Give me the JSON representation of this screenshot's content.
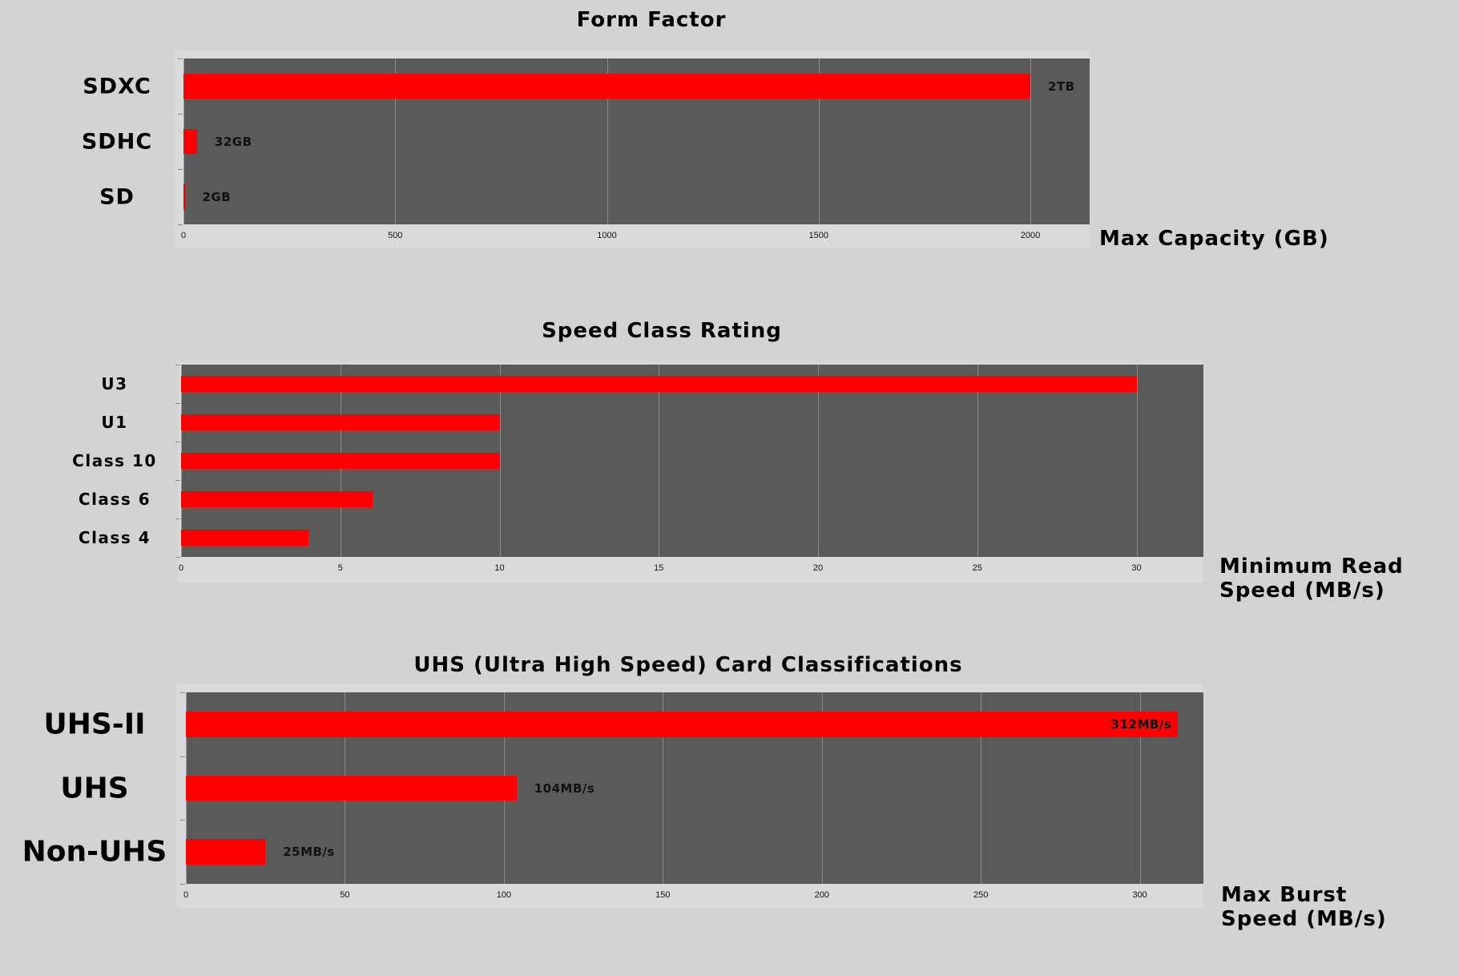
{
  "chart_data": [
    {
      "type": "bar",
      "orientation": "horizontal",
      "title": "Form Factor",
      "xlabel": "Max Capacity (GB)",
      "ylabel": "",
      "categories": [
        "SDXC",
        "SDHC",
        "SD"
      ],
      "values": [
        2000,
        32,
        2
      ],
      "data_labels": [
        "2TB",
        "32GB",
        "2GB"
      ],
      "xticks": [
        0,
        500,
        1000,
        1500,
        2000
      ],
      "xlim": [
        0,
        2140
      ],
      "grid": true,
      "legend": "none",
      "colors": {
        "bar": "#ff0000",
        "plot_bg": "#5a5a5a",
        "page_bg": "#d3d3d3"
      }
    },
    {
      "type": "bar",
      "orientation": "horizontal",
      "title": "Speed Class Rating",
      "xlabel": "Minimum Read Speed (MB/s)",
      "xlabel_lines": [
        "Minimum Read",
        "Speed (MB/s)"
      ],
      "ylabel": "",
      "categories": [
        "U3",
        "U1",
        "Class 10",
        "Class 6",
        "Class 4"
      ],
      "values": [
        30,
        10,
        10,
        6,
        4
      ],
      "data_labels": [],
      "xticks": [
        0,
        5,
        10,
        15,
        20,
        25,
        30
      ],
      "xlim": [
        0,
        32.1
      ],
      "grid": true,
      "legend": "none",
      "colors": {
        "bar": "#ff0000",
        "plot_bg": "#5a5a5a",
        "page_bg": "#d3d3d3"
      }
    },
    {
      "type": "bar",
      "orientation": "horizontal",
      "title": "UHS (Ultra High Speed) Card Classifications",
      "xlabel": "Max Burst Speed (MB/s)",
      "xlabel_lines": [
        "Max Burst",
        "Speed (MB/s)"
      ],
      "ylabel": "",
      "categories": [
        "UHS-II",
        "UHS",
        "Non-UHS"
      ],
      "values": [
        312,
        104,
        25
      ],
      "data_labels": [
        "312MB/s",
        "104MB/s",
        "25MB/s"
      ],
      "data_label_inside": [
        true,
        false,
        false
      ],
      "xticks": [
        0,
        50,
        100,
        150,
        200,
        250,
        300
      ],
      "xlim": [
        0,
        320
      ],
      "grid": true,
      "legend": "none",
      "colors": {
        "bar": "#ff0000",
        "plot_bg": "#5a5a5a",
        "page_bg": "#d3d3d3"
      }
    }
  ]
}
